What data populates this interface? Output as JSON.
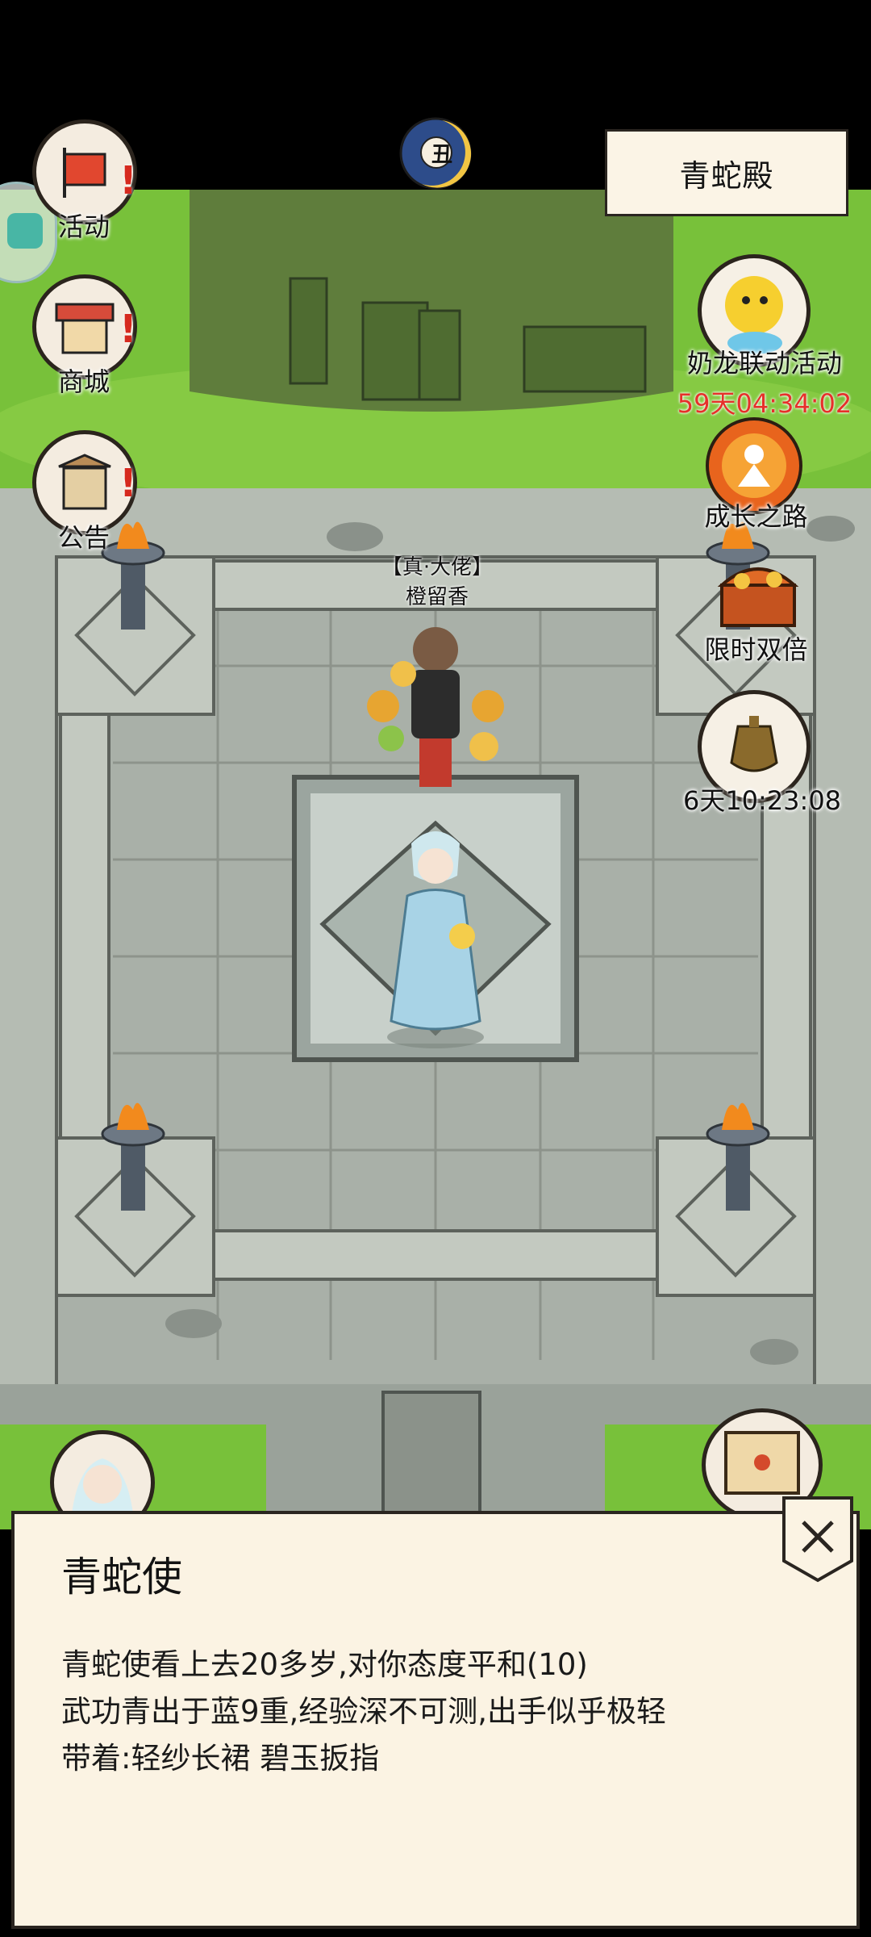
{
  "location": "青蛇殿",
  "time_badge": "丑",
  "left_buttons": [
    {
      "label": "活动",
      "icon": "banner-flag-icon"
    },
    {
      "label": "商城",
      "icon": "shop-stall-icon"
    },
    {
      "label": "公告",
      "icon": "notice-board-icon"
    }
  ],
  "right_events": {
    "collab_label": "奶龙联动活动",
    "collab_timer": "59天04:34:02",
    "growth_label": "成长之路",
    "double_label": "限时双倍",
    "urn_timer": "6天10:23:08"
  },
  "player": {
    "title": "【真·大佬】",
    "name": "橙留香"
  },
  "npc": {
    "name": "青蛇使",
    "line1": "青蛇使看上去20多岁,对你态度平和(10)",
    "line2": "武功青出于蓝9重,经验深不可测,出手似乎极轻",
    "line3": "带着:轻纱长裙 碧玉扳指"
  },
  "colors": {
    "grass": "#7bc53a",
    "stone": "#b9bfb7",
    "panel_bg": "#fbf3e3",
    "timer_red": "#e6302a"
  }
}
